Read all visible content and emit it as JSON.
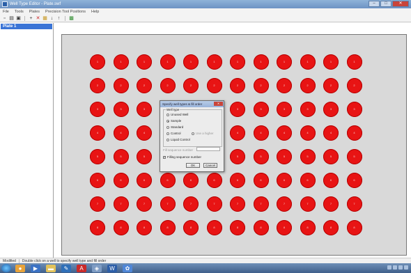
{
  "window": {
    "title": "Well Type Editor - Plate.swf",
    "buttons": [
      "–",
      "□",
      "✕"
    ]
  },
  "menu": [
    "File",
    "Tools",
    "Plates",
    "Precision Tool Positions",
    "Help"
  ],
  "toolbar_icons": [
    "new-icon",
    "open-icon",
    "save-icon",
    "add-icon",
    "delete-icon",
    "paste-icon",
    "down-arrow-icon",
    "up-arrow-icon",
    "grid-icon"
  ],
  "sidebar": {
    "items": [
      {
        "label": "Plate 1"
      }
    ]
  },
  "colors": {
    "well": "#e81414",
    "plate": "#d9d9d9",
    "selection": "#3a74d6"
  },
  "plate": {
    "rows": 8,
    "cols": 12,
    "well_labels": [
      [
        "1",
        "1",
        "1",
        "1",
        "1",
        "1",
        "1",
        "1",
        "1",
        "1",
        "1",
        "1"
      ],
      [
        "2",
        "2",
        "2",
        "2",
        "2",
        "2",
        "2",
        "2",
        "2",
        "2",
        "2",
        "2"
      ],
      [
        "3",
        "3",
        "3",
        "3",
        "3",
        "3",
        "3",
        "3",
        "3",
        "3",
        "3",
        "3"
      ],
      [
        "4",
        "4",
        "4",
        "4",
        "4",
        "4",
        "4",
        "4",
        "4",
        "4",
        "4",
        "4"
      ],
      [
        "5",
        "5",
        "5",
        "5",
        "5",
        "5",
        "5",
        "5",
        "5",
        "5",
        "5",
        "5"
      ],
      [
        "6",
        "6",
        "6",
        "6",
        "6",
        "6",
        "6",
        "6",
        "6",
        "6",
        "6",
        "6"
      ],
      [
        "7",
        "7",
        "7",
        "7",
        "7",
        "7",
        "7",
        "7",
        "7",
        "7",
        "7",
        "7"
      ],
      [
        "8",
        "8",
        "8",
        "8",
        "8",
        "8",
        "8",
        "8",
        "8",
        "8",
        "8",
        "8"
      ]
    ]
  },
  "dialog": {
    "title": "Specify well types & fill order",
    "close": "✕",
    "group_label": "Well type",
    "options": [
      {
        "label": "Unused Well",
        "checked": false
      },
      {
        "label": "Sample",
        "checked": true
      },
      {
        "label": "Standard",
        "checked": false
      },
      {
        "label": "Control",
        "checked": false
      },
      {
        "label": "Liquid Control",
        "checked": false
      }
    ],
    "control_extra_label": "Use a higher",
    "sequence_label": "Fill sequence number",
    "fill_checkbox_label": "Filling sequence number",
    "fill_checked": true,
    "ok": "OK",
    "cancel": "Cancel"
  },
  "status": {
    "mode": "Modified",
    "hint": "Double click on a well to specify well type and fill order"
  }
}
